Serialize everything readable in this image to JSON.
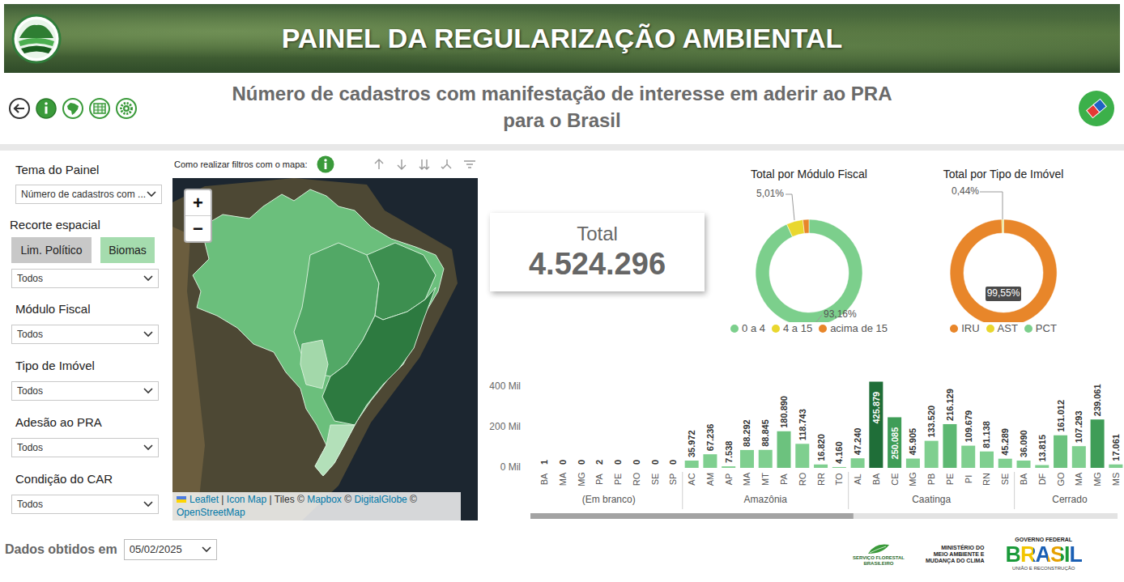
{
  "header": {
    "title": "PAINEL DA REGULARIZAÇÃO AMBIENTAL"
  },
  "page_title": {
    "lines": [
      "Número de cadastros com manifestação de interesse em aderir ao PRA",
      "para o Brasil"
    ]
  },
  "filters": {
    "theme": {
      "label": "Tema do Painel",
      "value": "Número de cadastros com ..."
    },
    "spatial": {
      "label": "Recorte espacial",
      "options": [
        {
          "label": "Lim. Político",
          "selected": false
        },
        {
          "label": "Biomas",
          "selected": true
        }
      ],
      "value": "Todos"
    },
    "dropdowns": [
      {
        "label": "Módulo Fiscal",
        "value": "Todos"
      },
      {
        "label": "Tipo de Imóvel",
        "value": "Todos"
      },
      {
        "label": "Adesão ao PRA",
        "value": "Todos"
      },
      {
        "label": "Condição do CAR",
        "value": "Todos"
      }
    ]
  },
  "map": {
    "help_text": "Como realizar filtros com o mapa:",
    "zoom_buttons": [
      "+",
      "−"
    ],
    "regions": [
      {
        "color": "#6bbf7c"
      },
      {
        "color": "#52a866"
      },
      {
        "color": "#3d8f50"
      },
      {
        "color": "#2d7a40"
      },
      {
        "color": "#a3d8aa"
      },
      {
        "color": "#b3e0b9"
      }
    ],
    "attribution": [
      {
        "text": "Leaflet",
        "kind": "link"
      },
      {
        "text": " | ",
        "kind": "text"
      },
      {
        "text": "Icon Map",
        "kind": "link"
      },
      {
        "text": " | Tiles © ",
        "kind": "text"
      },
      {
        "text": "Mapbox",
        "kind": "link"
      },
      {
        "text": " © ",
        "kind": "text"
      },
      {
        "text": "DigitalGlobe",
        "kind": "link"
      },
      {
        "text": " © ",
        "kind": "text"
      },
      {
        "text": "OpenStreetMap",
        "kind": "link"
      }
    ]
  },
  "total_card": {
    "label": "Total",
    "value": "4.524.296"
  },
  "donuts": [
    {
      "title": "Total por Módulo Fiscal",
      "slices": [
        {
          "legend": "0 a 4",
          "value": 93.16,
          "label": "93,16%",
          "color": "#7ccf8c"
        },
        {
          "legend": "4 a 15",
          "value": 5.01,
          "label": "5,01%",
          "color": "#e9d72e"
        },
        {
          "legend": "acima de 15",
          "value": 1.83,
          "color": "#e8862a"
        }
      ]
    },
    {
      "title": "Total por Tipo de Imóvel",
      "slices": [
        {
          "legend": "IRU",
          "value": 99.55,
          "label": "99,55%",
          "color": "#e8862a"
        },
        {
          "legend": "AST",
          "value": 0.44,
          "label": "0,44%",
          "color": "#e9d72e"
        },
        {
          "legend": "PCT",
          "value": 0.01,
          "color": "#7ccf8c"
        }
      ]
    }
  ],
  "bar_chart": {
    "y_ticks": [
      {
        "label": "400 Mil",
        "value": 400
      },
      {
        "label": "200 Mil",
        "value": 200
      },
      {
        "label": "0 Mil",
        "value": 0
      }
    ],
    "groups": [
      {
        "label": "(Em branco)",
        "bars": [
          {
            "state": "BA",
            "value": 0.001,
            "label": "1",
            "color": "#7fcf8f"
          },
          {
            "state": "MA",
            "value": 0,
            "label": "0",
            "color": "#7fcf8f"
          },
          {
            "state": "MG",
            "value": 0,
            "label": "0",
            "color": "#7fcf8f"
          },
          {
            "state": "PA",
            "value": 0.002,
            "label": "2",
            "color": "#7fcf8f"
          },
          {
            "state": "PE",
            "value": 0,
            "label": "0",
            "color": "#7fcf8f"
          },
          {
            "state": "RO",
            "value": 0,
            "label": "0",
            "color": "#7fcf8f"
          },
          {
            "state": "SE",
            "value": 0,
            "label": "0",
            "color": "#7fcf8f"
          },
          {
            "state": "SP",
            "value": 0,
            "label": "0",
            "color": "#7fcf8f"
          }
        ]
      },
      {
        "label": "Amazônia",
        "bars": [
          {
            "state": "AC",
            "value": 35.972,
            "label": "35.972",
            "color": "#7fcf8f"
          },
          {
            "state": "AM",
            "value": 67.236,
            "label": "67.236",
            "color": "#7fcf8f"
          },
          {
            "state": "AP",
            "value": 7.538,
            "label": "7.538",
            "color": "#7fcf8f"
          },
          {
            "state": "MA",
            "value": 88.292,
            "label": "88.292",
            "color": "#7fcf8f"
          },
          {
            "state": "MT",
            "value": 88.845,
            "label": "88.845",
            "color": "#7fcf8f"
          },
          {
            "state": "PA",
            "value": 180.89,
            "label": "180.890",
            "color": "#6cc27e"
          },
          {
            "state": "RO",
            "value": 118.743,
            "label": "118.743",
            "color": "#7fcf8f"
          },
          {
            "state": "RR",
            "value": 16.82,
            "label": "16.820",
            "color": "#7fcf8f"
          },
          {
            "state": "TO",
            "value": 4.16,
            "label": "4.160",
            "color": "#7fcf8f"
          }
        ]
      },
      {
        "label": "Caatinga",
        "bars": [
          {
            "state": "AL",
            "value": 47.24,
            "label": "47.240",
            "color": "#7fcf8f"
          },
          {
            "state": "BA",
            "value": 425.879,
            "label": "425.879",
            "color": "#1f6e38"
          },
          {
            "state": "CE",
            "value": 250.085,
            "label": "250.085",
            "color": "#3f9d57"
          },
          {
            "state": "MG",
            "value": 45.905,
            "label": "45.905",
            "color": "#7fcf8f"
          },
          {
            "state": "PB",
            "value": 133.52,
            "label": "133.520",
            "color": "#7fcf8f"
          },
          {
            "state": "PE",
            "value": 216.129,
            "label": "216.129",
            "color": "#5db872"
          },
          {
            "state": "PI",
            "value": 109.679,
            "label": "109.679",
            "color": "#7fcf8f"
          },
          {
            "state": "RN",
            "value": 81.138,
            "label": "81.138",
            "color": "#7fcf8f"
          },
          {
            "state": "SE",
            "value": 45.289,
            "label": "45.289",
            "color": "#7fcf8f"
          }
        ]
      },
      {
        "label": "Cerrado",
        "bars": [
          {
            "state": "BA",
            "value": 36.09,
            "label": "36.090",
            "color": "#7fcf8f"
          },
          {
            "state": "DF",
            "value": 13.815,
            "label": "13.815",
            "color": "#7fcf8f"
          },
          {
            "state": "GO",
            "value": 161.012,
            "label": "161.012",
            "color": "#6cc27e"
          },
          {
            "state": "MA",
            "value": 107.293,
            "label": "107.293",
            "color": "#7fcf8f"
          },
          {
            "state": "MG",
            "value": 239.061,
            "label": "239.061",
            "color": "#3f9d57"
          },
          {
            "state": "MS",
            "value": 17.061,
            "label": "17.061",
            "color": "#7fcf8f"
          }
        ]
      }
    ],
    "scrollbar": {
      "level": 0.55
    }
  },
  "footer": {
    "date_label": "Dados obtidos em",
    "date_value": "05/02/2025",
    "sfb": [
      "SERVIÇO FLORESTAL",
      "BRASILEIRO"
    ],
    "mma": [
      "MINISTÉRIO DO",
      "MEIO AMBIENTE E",
      "MUDANÇA DO CLIMA"
    ],
    "gov": {
      "top": "GOVERNO FEDERAL",
      "main": "BRASIL",
      "bottom": "UNIÃO E RECONSTRUÇÃO"
    }
  }
}
